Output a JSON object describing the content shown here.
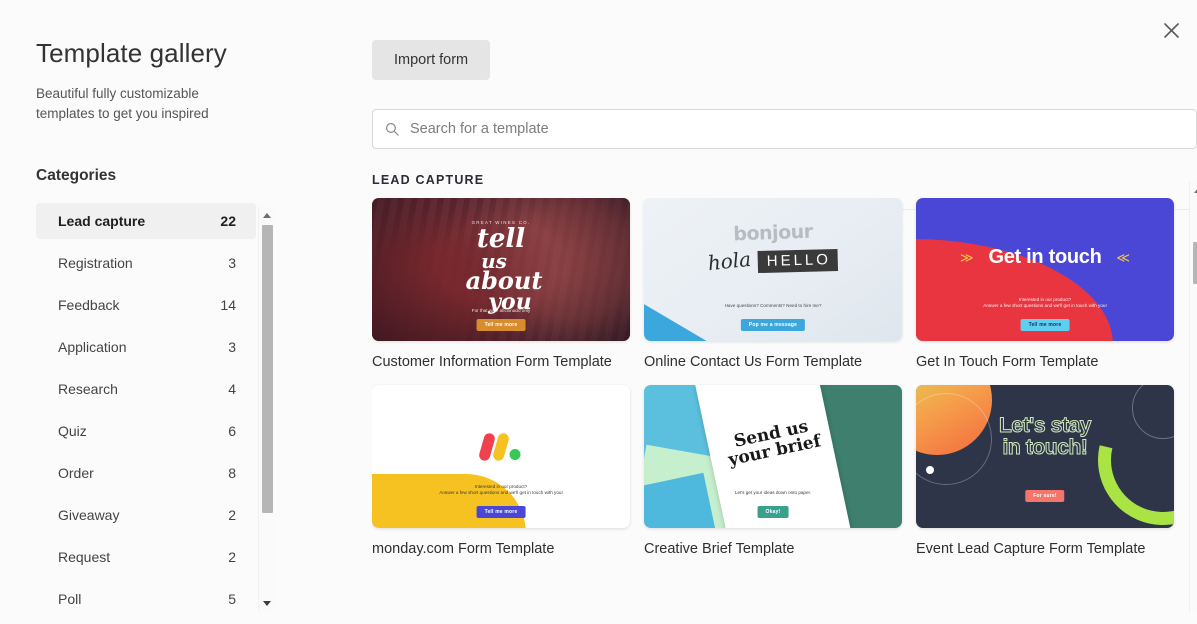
{
  "window": {
    "close_label": "×"
  },
  "sidebar": {
    "title": "Template gallery",
    "subtitle": "Beautiful fully customizable templates to get you inspired",
    "categories_heading": "Categories",
    "categories": [
      {
        "label": "Lead capture",
        "count": "22",
        "active": true
      },
      {
        "label": "Registration",
        "count": "3",
        "active": false
      },
      {
        "label": "Feedback",
        "count": "14",
        "active": false
      },
      {
        "label": "Application",
        "count": "3",
        "active": false
      },
      {
        "label": "Research",
        "count": "4",
        "active": false
      },
      {
        "label": "Quiz",
        "count": "6",
        "active": false
      },
      {
        "label": "Order",
        "count": "8",
        "active": false
      },
      {
        "label": "Giveaway",
        "count": "2",
        "active": false
      },
      {
        "label": "Request",
        "count": "2",
        "active": false
      },
      {
        "label": "Poll",
        "count": "5",
        "active": false
      }
    ]
  },
  "toolbar": {
    "import_label": "Import form"
  },
  "search": {
    "placeholder": "Search for a template",
    "value": "",
    "icon": "search-icon"
  },
  "main": {
    "section_label": "LEAD CAPTURE",
    "templates": [
      {
        "title": "Customer Information Form Template",
        "thumb": {
          "kind": "wine-barrels",
          "eyebrow": "GREAT WINES CO.",
          "script_lines": [
            "tell",
            "us",
            "about",
            "you"
          ],
          "sub": "For that wine aficionado only",
          "cta": "Tell me more"
        }
      },
      {
        "title": "Online Contact Us Form Template",
        "thumb": {
          "kind": "bonjour-hello",
          "word1": "bonjour",
          "word2": "hola",
          "word3": "HELLO",
          "sub": "Have questions? Comments? Need to hire me?",
          "cta": "Pop me a message"
        }
      },
      {
        "title": "Get In Touch Form Template",
        "thumb": {
          "kind": "get-in-touch",
          "headline": "Get in touch",
          "sub": "Interested in our product?\nAnswer a few short questions and we'll get in touch with you!",
          "cta": "Tell me more"
        }
      },
      {
        "title": "monday.com Form Template",
        "thumb": {
          "kind": "monday-logo",
          "sub": "Interested in our product?\nAnswer a few short questions and we'll get in touch with you!",
          "cta": "Tell me more"
        }
      },
      {
        "title": "Creative Brief Template",
        "thumb": {
          "kind": "creative-brief",
          "headline": "Send us\nyour brief",
          "sub": "Let's get your ideas down onto paper.",
          "cta": "Okay!"
        }
      },
      {
        "title": "Event Lead Capture Form Template",
        "thumb": {
          "kind": "event-lead",
          "headline": "Let's stay\nin touch!",
          "cta": "For sure!"
        }
      }
    ]
  },
  "colors": {
    "page_bg": "#fbfbfb",
    "active_item_bg": "#f0f0f0",
    "import_btn_bg": "#e5e5e5",
    "scrollbar_thumb": "#b6b6b6",
    "card_get_in_touch_purple": "#4b47d6",
    "card_get_in_touch_red": "#e8353f",
    "monday_red": "#f0414f",
    "monday_yellow": "#f6c222",
    "monday_green": "#3bc756",
    "event_navy": "#2e3549",
    "event_green": "#a9e444",
    "event_coral": "#f4766a"
  }
}
